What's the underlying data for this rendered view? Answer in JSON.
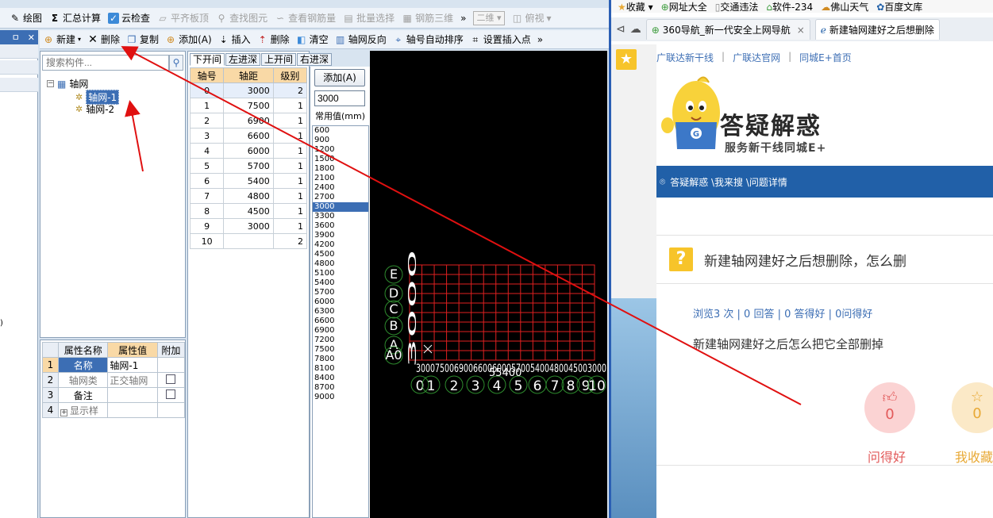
{
  "app": {
    "toolbar1": {
      "draw": "绘图",
      "summary": "汇总计算",
      "cloud_check": "云检查",
      "flat_slab": "平齐板顶",
      "find_element": "查找图元",
      "view_rebar": "查看钢筋量",
      "batch_select": "批量选择",
      "rebar_3d": "钢筋三维",
      "more": "»",
      "view_mode": "二维",
      "view_angle": "俯视"
    },
    "panel_header": {
      "pin": "ㅁ",
      "close": "✕"
    },
    "toolbar2": {
      "new": "新建",
      "delete": "删除",
      "copy": "复制",
      "add": "添加(A)",
      "insert": "插入",
      "delete2": "删除",
      "clear": "清空",
      "reverse": "轴网反向",
      "auto_sort": "轴号自动排序",
      "set_insert_point": "设置插入点",
      "more": "»"
    },
    "tree": {
      "search_placeholder": "搜索构件...",
      "root": "轴网",
      "children": [
        "轴网-1",
        "轴网-2"
      ]
    },
    "props": {
      "headers": [
        "属性名称",
        "属性值",
        "附加"
      ],
      "rows": [
        {
          "idx": "1",
          "name": "名称",
          "value": "轴网-1"
        },
        {
          "idx": "2",
          "name": "轴网类",
          "value": "正交轴网"
        },
        {
          "idx": "3",
          "name": "备注",
          "value": ""
        },
        {
          "idx": "4",
          "name": "显示样",
          "value": ""
        }
      ]
    },
    "axis_tabs": [
      "下开间",
      "左进深",
      "上开间",
      "右进深"
    ],
    "axis_table": {
      "headers": [
        "轴号",
        "轴距",
        "级别"
      ],
      "rows": [
        [
          "0",
          "3000",
          "2"
        ],
        [
          "1",
          "7500",
          "1"
        ],
        [
          "2",
          "6900",
          "1"
        ],
        [
          "3",
          "6600",
          "1"
        ],
        [
          "4",
          "6000",
          "1"
        ],
        [
          "5",
          "5700",
          "1"
        ],
        [
          "6",
          "5400",
          "1"
        ],
        [
          "7",
          "4800",
          "1"
        ],
        [
          "8",
          "4500",
          "1"
        ],
        [
          "9",
          "3000",
          "1"
        ],
        [
          "10",
          "",
          "2"
        ]
      ]
    },
    "value_panel": {
      "add_button": "添加(A)",
      "input_value": "3000",
      "common_label": "常用值(mm)",
      "values": [
        "600",
        "900",
        "1200",
        "1500",
        "1800",
        "2100",
        "2400",
        "2700",
        "3000",
        "3300",
        "3600",
        "3900",
        "4200",
        "4500",
        "4800",
        "5100",
        "5400",
        "5700",
        "6000",
        "6300",
        "6600",
        "6900",
        "7200",
        "7500",
        "7800",
        "8100",
        "8400",
        "8700",
        "9000"
      ],
      "selected": "3000"
    },
    "canvas": {
      "row_labels": [
        "E",
        "D",
        "C",
        "B",
        "A",
        "A0"
      ],
      "col_labels": [
        "0",
        "1",
        "2",
        "3",
        "4",
        "5",
        "6",
        "7",
        "8",
        "9",
        "10"
      ],
      "bottom_dims": "3000750069006600600057005400480045003000",
      "total_dim": "55400",
      "side_dims": "3000",
      "grid_color": "#e02020",
      "label_color": "#ffffff",
      "bubble_color": "#2e8b2e"
    }
  },
  "browser": {
    "bookmarks": [
      "收藏",
      "网址大全",
      "交通违法",
      "软件-234",
      "佛山天气",
      "百度文库"
    ],
    "tabs": [
      {
        "title": "360导航_新一代安全上网导航",
        "close": "×"
      },
      {
        "title": "新建轴网建好之后想删除",
        "close": ""
      }
    ],
    "top_links": [
      "广联达新干线",
      "广联达官网",
      "同城E+首页"
    ],
    "brand": {
      "title": "答疑解惑",
      "subtitle": "服务新干线同城E+",
      "mascot_letter": "G"
    },
    "breadcrumb": "答疑解惑 \\我来搜 \\问题详情",
    "question": {
      "title": "新建轴网建好之后想删除，怎么删",
      "stats": "浏览3 次 | 0 回答 | 0 答得好 | 0问得好",
      "body": "新建轴网建好之后怎么把它全部删掉"
    },
    "actions": [
      {
        "label": "问得好",
        "count": "0"
      },
      {
        "label": "我收藏",
        "count": "0"
      }
    ]
  },
  "colors": {
    "annotation_arrow": "#e01010",
    "app_accent": "#3c6eb4",
    "browser_bar": "#2160a8",
    "question_icon": "#f7c42a"
  }
}
